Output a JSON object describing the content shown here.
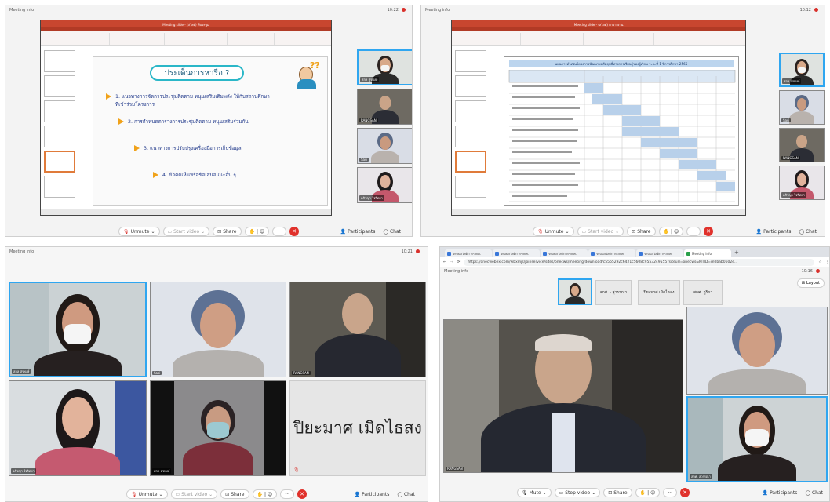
{
  "meeting_info": "Meeting info",
  "toolbar": {
    "unmute": "Unmute",
    "start_video": "Start video",
    "stop_video": "Stop video",
    "mute": "Mute",
    "share": "Share",
    "participants": "Participants",
    "chat": "Chat"
  },
  "q1": {
    "clock": "10:22",
    "ppt_title": "Meeting slide - (สไลด์) ที่ประชุม",
    "slide_title": "ประเด็นการหารือ ?",
    "bullets": [
      "1. แนวทางการจัดการประชุมติดตาม หนุนเสริมเติมพลัง ให้กับสถานศึกษา",
      "ที่เข้าร่วมโครงการ",
      "2. การกำหนดตารางการประชุมติดตาม หนุนเสริมร่วมกัน",
      "3. แนวทางการปรับปรุงเครื่องมือการเก็บข้อมูล",
      "4. ข้อคิดเห็นหรือข้อเสนอแนะอื่น ๆ"
    ],
    "names": [
      "สกล สุรพงษ์",
      "RANGSAN",
      "Sasi",
      "อภิรญา ใจวิทยา"
    ]
  },
  "q2": {
    "clock": "10:12",
    "ppt_title": "Meeting slide - (สไลด์) ตารางงาน",
    "table_title": "แผนการดำเนินโครงการพัฒนาผลสัมฤทธิ์ทางการเรียนรู้ของผู้เรียน ระยะที่ 1 ปีการศึกษา 2565",
    "names": [
      "สกล สุรพงษ์",
      "Sasi",
      "RANGSAN",
      "อภิรญา ใจวิทยา"
    ]
  },
  "q3": {
    "clock": "10:21",
    "names": [
      "สกล สุรพงษ์",
      "Sasi",
      "RANGSAN",
      "อภิรญา ใจวิทยา",
      "สกล สุรพงษ์"
    ],
    "big_name": "ปิยะมาศ เมิดไธสง"
  },
  "q4": {
    "tabs": [
      "ระบบสวัสดิการ-สกศ.",
      "ระบบสวัสดิการ-สกศ.",
      "ระบบสวัสดิการ-สกศ.",
      "ระบบสวัสดิการ-สกศ.",
      "ระบบสวัสดิการ-สกศ.",
      "Meeting info"
    ],
    "url": "https://onecwebex.com/wbxmjs/joinservice/sites/onecws/meeting/download/c55b5292c6421c5608c9553249555?siteurl=onecws&MTID=m0bab0602e...",
    "clock": "10:16",
    "layout": "Layout",
    "strip": [
      "สกศ. - สุวรรณา",
      "ปิยะมาศ เมิดไธสง",
      "สกศ. ภูริกา"
    ],
    "names": [
      "RANGSAN",
      "สกศ. สุวรรณา",
      "Sasi"
    ]
  }
}
